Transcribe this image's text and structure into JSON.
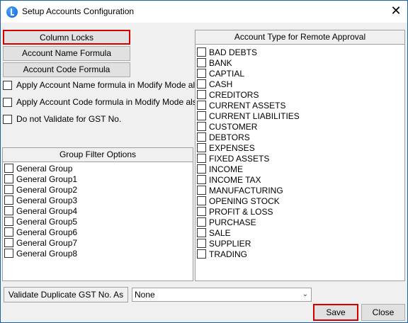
{
  "window": {
    "title": "Setup Accounts Configuration"
  },
  "buttons": {
    "column_locks": "Column Locks",
    "account_name_formula": "Account Name Formula",
    "account_code_formula": "Account Code Formula",
    "save": "Save",
    "close": "Close"
  },
  "options": [
    {
      "label": "Apply Account Name formula in Modify Mode also",
      "checked": false
    },
    {
      "label": "Apply Account Code formula in Modify Mode also",
      "checked": false
    },
    {
      "label": "Do not Validate for GST No.",
      "checked": false
    }
  ],
  "group_filter": {
    "title": "Group Filter Options",
    "items": [
      "General Group",
      "General Group1",
      "General Group2",
      "General Group3",
      "General Group4",
      "General Group5",
      "General Group6",
      "General Group7",
      "General Group8"
    ]
  },
  "account_types": {
    "title": "Account Type for Remote Approval",
    "items": [
      "BAD DEBTS",
      "BANK",
      "CAPTIAL",
      "CASH",
      "CREDITORS",
      "CURRENT ASSETS",
      "CURRENT LIABILITIES",
      "CUSTOMER",
      "DEBTORS",
      "EXPENSES",
      "FIXED ASSETS",
      "INCOME",
      "INCOME TAX",
      "MANUFACTURING",
      "OPENING STOCK",
      "PROFIT & LOSS",
      "PURCHASE",
      "SALE",
      "SUPPLIER",
      "TRADING"
    ]
  },
  "validate_duplicate": {
    "label": "Validate Duplicate GST No. As",
    "value": "None"
  },
  "icons": {
    "app": "app-icon",
    "close": "close-icon",
    "dropdown": "chevron-down-icon"
  }
}
